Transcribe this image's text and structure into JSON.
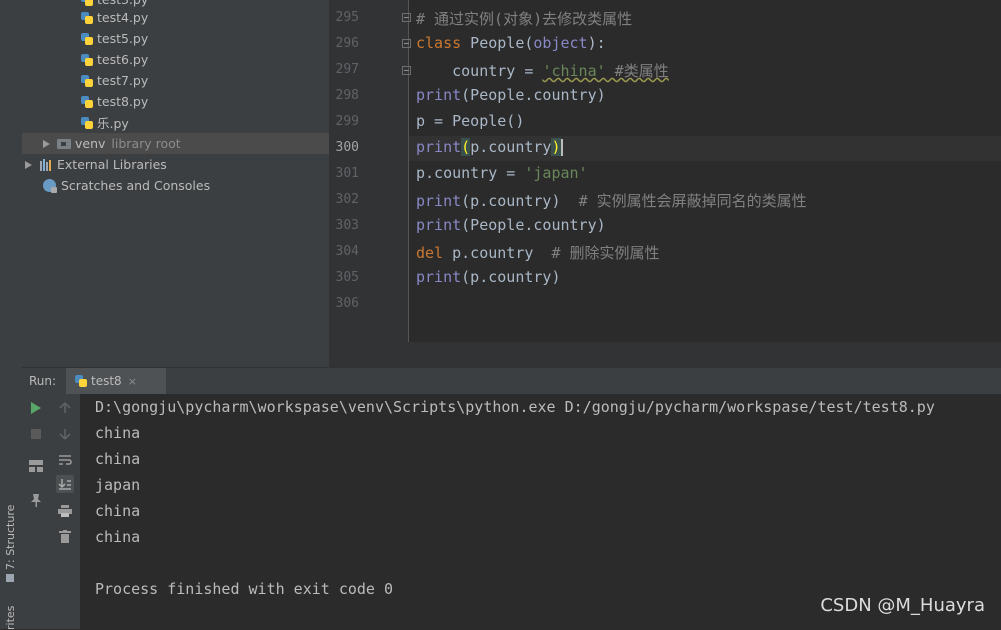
{
  "project_tree": {
    "files": [
      "test4.py",
      "test5.py",
      "test6.py",
      "test7.py",
      "test8.py",
      "乐.py"
    ],
    "venv": {
      "label": "venv",
      "suffix": "library root"
    },
    "external_libraries": "External Libraries",
    "scratches": "Scratches and Consoles"
  },
  "side_tabs": {
    "structure": "7: Structure",
    "favorites": "rites"
  },
  "editor": {
    "line_numbers": [
      "295",
      "296",
      "297",
      "298",
      "299",
      "300",
      "301",
      "302",
      "303",
      "304",
      "305",
      "306"
    ],
    "current_line": "300",
    "tokens": {
      "l295_comment": "# 通过实例(对象)去修改类属性",
      "l296_kw": "class",
      "l296_name": " People(",
      "l296_base": "object",
      "l296_end": "):",
      "l297_lead": "    country = ",
      "l297_str": "'china'",
      "l297_comment": " #类属性",
      "l298_fn": "print",
      "l298_rest": "(People.country)",
      "l299": "p = People()",
      "l300_fn": "print",
      "l300_open": "(",
      "l300_mid": "p.country",
      "l300_close": ")",
      "l301_lead": "p.country = ",
      "l301_str": "'japan'",
      "l302_fn": "print",
      "l302_rest": "(p.country)  ",
      "l302_comment": "# 实例属性会屏蔽掉同名的类属性",
      "l303_fn": "print",
      "l303_rest": "(People.country)",
      "l304_kw": "del",
      "l304_rest": " p.country  ",
      "l304_comment": "# 删除实例属性",
      "l305_fn": "print",
      "l305_rest": "(p.country)"
    }
  },
  "run_panel": {
    "label": "Run:",
    "tab": "test8",
    "tab_close": "×",
    "output": [
      "D:\\gongju\\pycharm\\workspase\\venv\\Scripts\\python.exe D:/gongju/pycharm/workspase/test/test8.py",
      "china",
      "china",
      "japan",
      "china",
      "china",
      "",
      "Process finished with exit code 0"
    ]
  },
  "watermark": "CSDN @M_Huayra"
}
